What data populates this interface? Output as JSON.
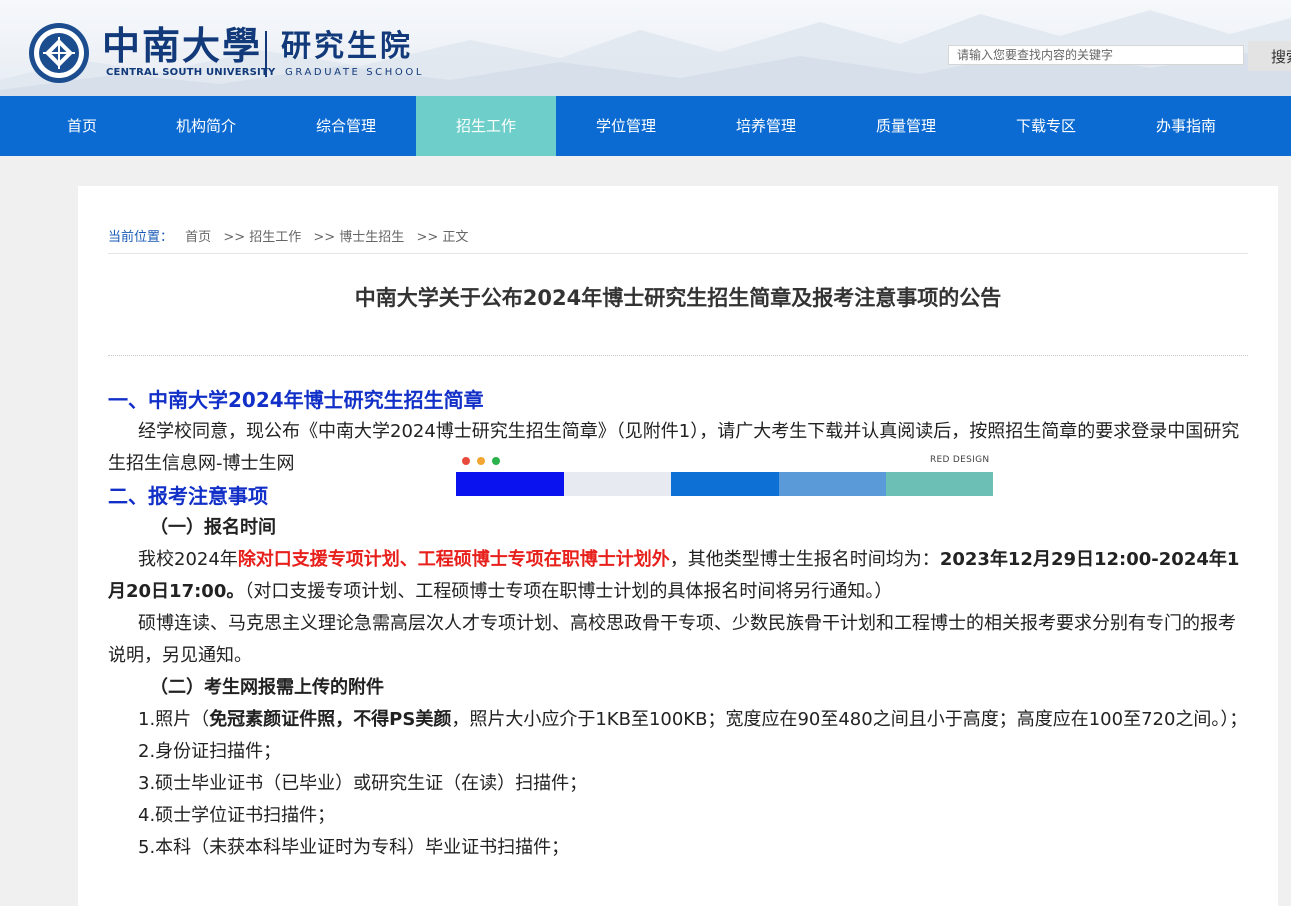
{
  "header": {
    "logo_cn": "中南大學",
    "logo_en": "CENTRAL SOUTH UNIVERSITY",
    "school_cn": "研究生院",
    "school_en": "GRADUATE SCHOOL",
    "search_placeholder": "请输入您要查找内容的关键字",
    "search_button": "搜索"
  },
  "nav": {
    "items": [
      {
        "label": "首页"
      },
      {
        "label": "机构简介"
      },
      {
        "label": "综合管理"
      },
      {
        "label": "招生工作",
        "active": true
      },
      {
        "label": "学位管理"
      },
      {
        "label": "培养管理"
      },
      {
        "label": "质量管理"
      },
      {
        "label": "下载专区"
      },
      {
        "label": "办事指南"
      }
    ],
    "active_color": "#6ecfca",
    "bar_color": "#0b6bd2"
  },
  "breadcrumb": {
    "label": "当前位置：",
    "items": [
      "首页",
      ">> 招生工作",
      ">> 博士生招生",
      ">> 正文"
    ]
  },
  "article": {
    "title": "中南大学关于公布2024年博士研究生招生简章及报考注意事项的公告",
    "section1_heading": "一、中南大学2024年博士研究生招生简章",
    "section1_para": "经学校同意，现公布《中南大学2024博士研究生招生简章》（见附件1），请广大考生下载并认真阅读后，按照招生简章的要求登录中国研究生招生信息网-博士生网",
    "section2_heading": "二、报考注意事项",
    "sub1_heading": "（一）报名时间",
    "sub1_para_a": "我校2024年",
    "sub1_para_red": "除对口支援专项计划、工程硕博士专项在职博士计划外",
    "sub1_para_b": "，其他类型博士生报名时间均为：",
    "sub1_para_bold": "2023年12月29日12:00-2024年1月20日17:00。",
    "sub1_para_c": "（对口支援专项计划、工程硕博士专项在职博士计划的具体报名时间将另行通知。）",
    "sub1_para2": "硕博连读、马克思主义理论急需高层次人才专项计划、高校思政骨干专项、少数民族骨干计划和工程博士的相关报考要求分别有专门的报考说明，另见通知。",
    "sub2_heading": "（二）考生网报需上传的附件",
    "item1_a": "1.照片（",
    "item1_bold1": "免冠素颜证件照",
    "item1_sep": "，",
    "item1_bold2": "不得PS美颜",
    "item1_b": "，照片大小应介于1KB至100KB；宽度应在90至480之间且小于高度；高度应在100至720之间。）；",
    "item2": "2.身份证扫描件；",
    "item3": "3.硕士毕业证书（已毕业）或研究生证（在读）扫描件；",
    "item4": "4.硕士学位证书扫描件；",
    "item5": "5.本科（未获本科毕业证时为专科）毕业证书扫描件；"
  },
  "overlay": {
    "label": "RED DESIGN",
    "dot_colors": [
      "#e84a3b",
      "#f2a531",
      "#2bb24c"
    ],
    "swatches": [
      "#0a12f0",
      "#e7ebf1",
      "#0c70d4",
      "#5a9ad8",
      "#6bbfb5"
    ]
  }
}
